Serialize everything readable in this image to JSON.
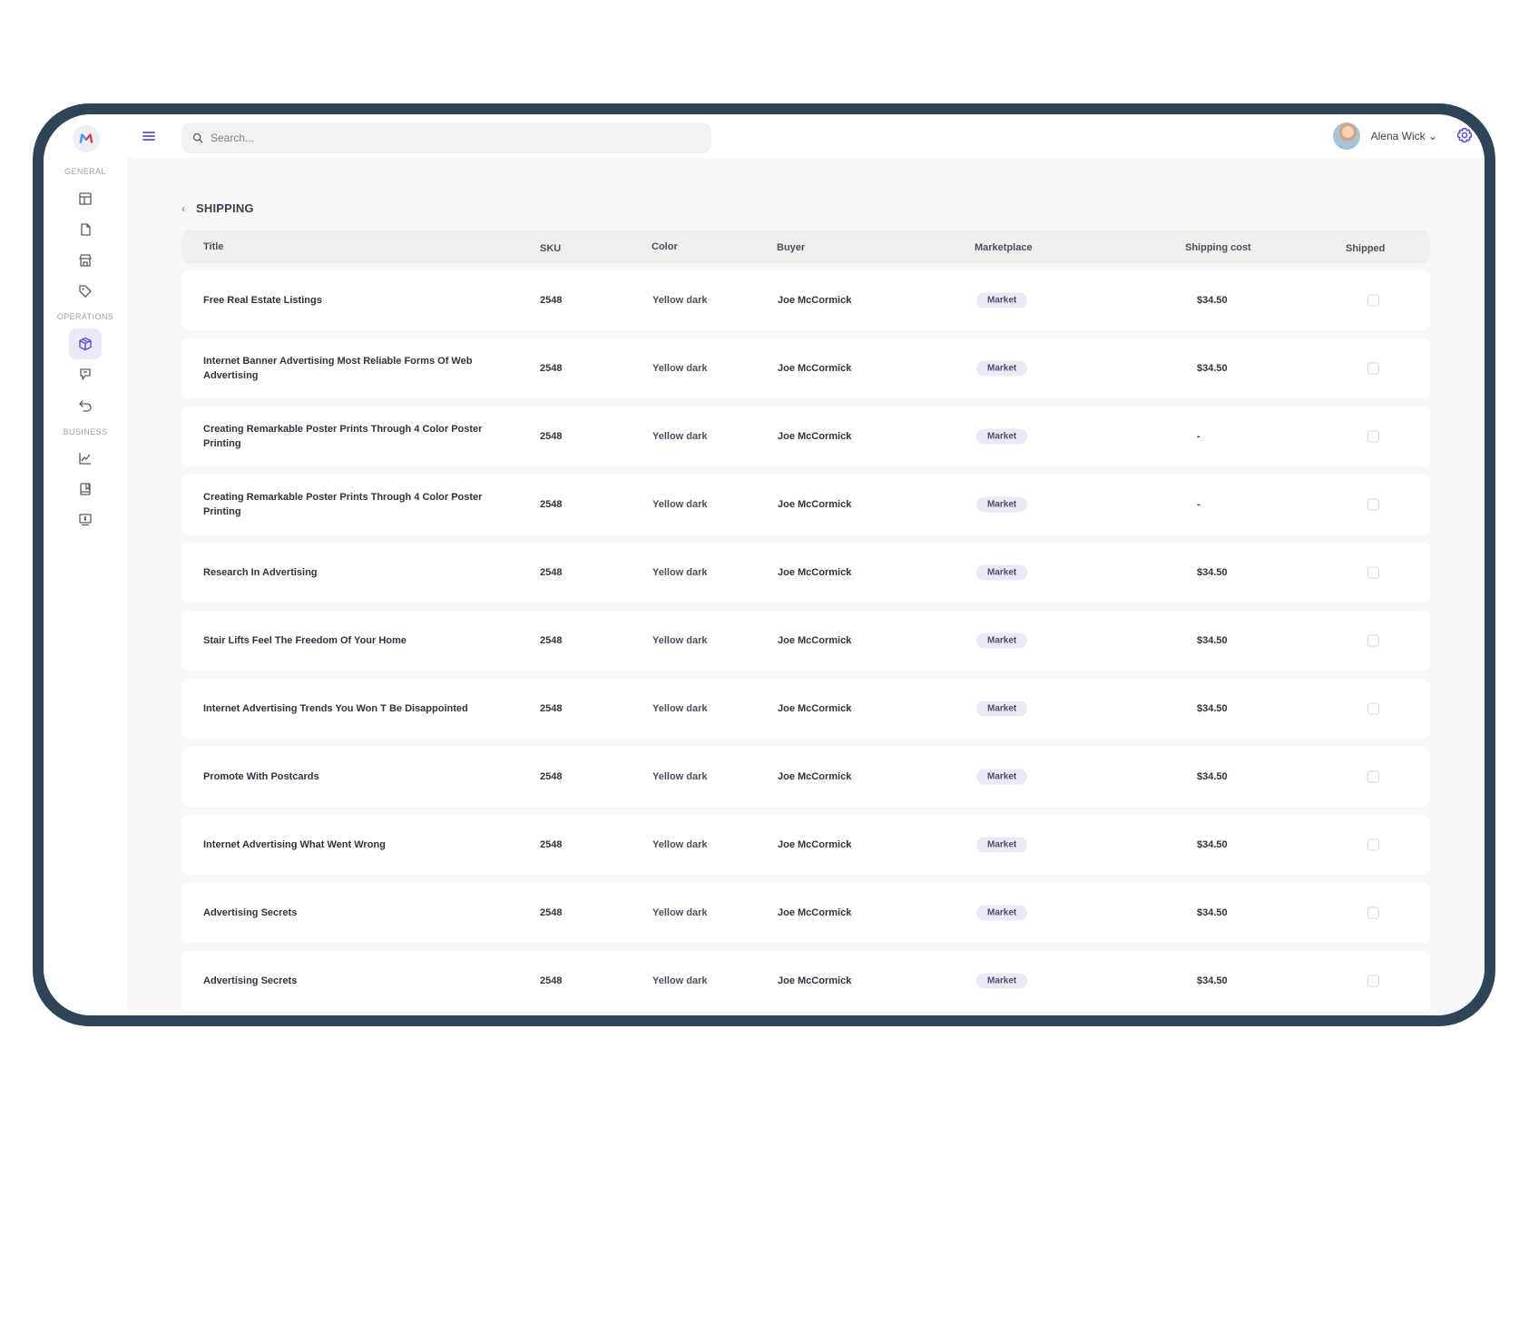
{
  "search": {
    "placeholder": "Search..."
  },
  "user": {
    "name": "Alena Wick ⌄"
  },
  "sidebar": {
    "sections": [
      "General",
      "Operations",
      "Business"
    ]
  },
  "page": {
    "title": "SHIPPING"
  },
  "table": {
    "headers": [
      "Title",
      "SKU",
      "Color",
      "Buyer",
      "Marketplace",
      "Shipping cost",
      "Shipped"
    ],
    "rows": [
      {
        "title": "Free Real Estate Listings",
        "sku": "2548",
        "color": "Yellow dark",
        "buyer": "Joe McCormick",
        "marketplace": "Market",
        "cost": "$34.50"
      },
      {
        "title": "Internet Banner Advertising Most Reliable Forms Of Web Advertising",
        "sku": "2548",
        "color": "Yellow dark",
        "buyer": "Joe McCormick",
        "marketplace": "Market",
        "cost": "$34.50"
      },
      {
        "title": "Creating Remarkable Poster Prints Through 4 Color Poster Printing",
        "sku": "2548",
        "color": "Yellow dark",
        "buyer": "Joe McCormick",
        "marketplace": "Market",
        "cost": "-"
      },
      {
        "title": "Creating Remarkable Poster Prints Through 4 Color Poster Printing",
        "sku": "2548",
        "color": "Yellow dark",
        "buyer": "Joe McCormick",
        "marketplace": "Market",
        "cost": "-"
      },
      {
        "title": "Research In Advertising",
        "sku": "2548",
        "color": "Yellow dark",
        "buyer": "Joe McCormick",
        "marketplace": "Market",
        "cost": "$34.50"
      },
      {
        "title": "Stair Lifts Feel The Freedom Of Your Home",
        "sku": "2548",
        "color": "Yellow dark",
        "buyer": "Joe McCormick",
        "marketplace": "Market",
        "cost": "$34.50"
      },
      {
        "title": "Internet Advertising Trends You Won T Be Disappointed",
        "sku": "2548",
        "color": "Yellow dark",
        "buyer": "Joe McCormick",
        "marketplace": "Market",
        "cost": "$34.50"
      },
      {
        "title": "Promote With Postcards",
        "sku": "2548",
        "color": "Yellow dark",
        "buyer": "Joe McCormick",
        "marketplace": "Market",
        "cost": "$34.50"
      },
      {
        "title": "Internet Advertising What Went Wrong",
        "sku": "2548",
        "color": "Yellow dark",
        "buyer": "Joe McCormick",
        "marketplace": "Market",
        "cost": "$34.50"
      },
      {
        "title": "Advertising Secrets",
        "sku": "2548",
        "color": "Yellow dark",
        "buyer": "Joe McCormick",
        "marketplace": "Market",
        "cost": "$34.50"
      },
      {
        "title": "Advertising Secrets",
        "sku": "2548",
        "color": "Yellow dark",
        "buyer": "Joe McCormick",
        "marketplace": "Market",
        "cost": "$34.50"
      }
    ]
  },
  "colors": {
    "accent": "#5b4fd0",
    "frame": "#2f4458",
    "badge_bg": "#ebe9f5"
  }
}
